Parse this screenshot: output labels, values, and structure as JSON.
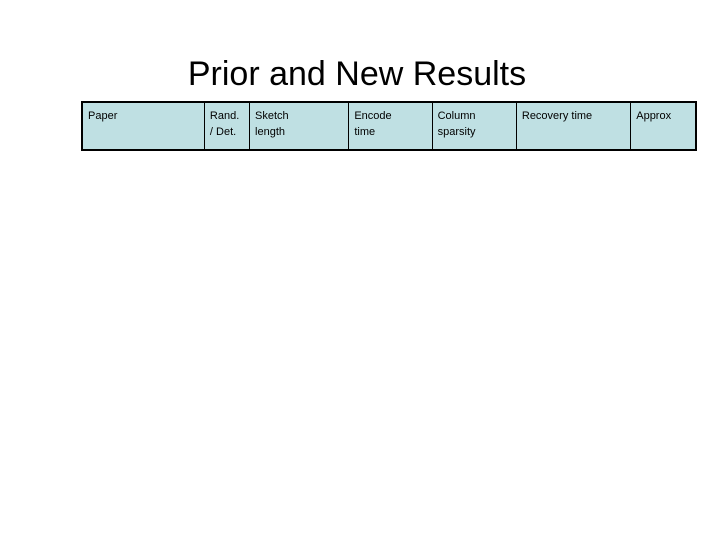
{
  "slide": {
    "title": "Prior and New Results",
    "background_color": "#ffffff",
    "title_color": "#000000"
  },
  "table": {
    "header_fill_color": "#bfe0e3",
    "border_color": "#000000",
    "text_color": "#000000",
    "columns": [
      {
        "key": "paper",
        "label": "Paper",
        "lines": [
          "Paper"
        ]
      },
      {
        "key": "rand_det",
        "label": "Rand. / Det.",
        "lines": [
          "Rand.",
          "/ Det."
        ]
      },
      {
        "key": "sketch_length",
        "label": "Sketch length",
        "lines": [
          "Sketch",
          "length"
        ]
      },
      {
        "key": "encode_time",
        "label": "Encode time",
        "lines": [
          "Encode",
          "time"
        ]
      },
      {
        "key": "column_sparsity",
        "label": "Column sparsity",
        "lines": [
          "Column",
          "sparsity"
        ]
      },
      {
        "key": "recovery_time",
        "label": "Recovery time",
        "lines": [
          "Recovery time"
        ]
      },
      {
        "key": "approx",
        "label": "Approx",
        "lines": [
          "Approx"
        ]
      }
    ],
    "rows": []
  }
}
